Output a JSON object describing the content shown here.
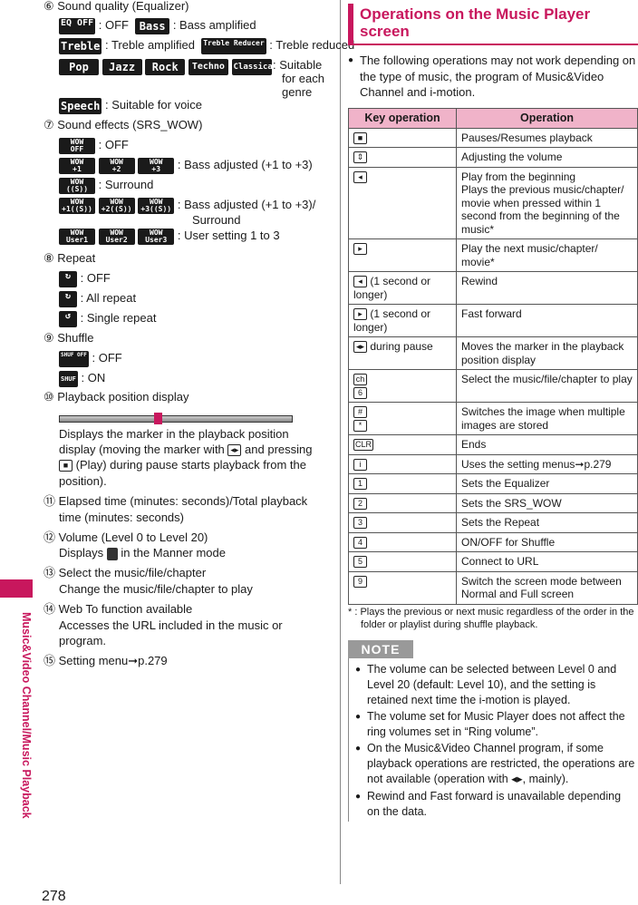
{
  "left": {
    "s6": {
      "title": "⑥ Sound quality (Equalizer)",
      "eq_off_icon": "EQ OFF",
      "eq_off": ": OFF",
      "bass_icon": "Bass",
      "bass": ": Bass amplified",
      "treble_icon": "Treble",
      "treble": ": Treble amplified",
      "treble_red_icon": "Treble Reducer",
      "treble_red": ": Treble reduced",
      "genres": [
        "Pop",
        "Jazz",
        "Rock",
        "Techno",
        "Classical"
      ],
      "genre_text1": ": Suitable",
      "genre_text2": "for each",
      "genre_text3": "genre",
      "speech_icon": "Speech",
      "speech": ": Suitable for voice"
    },
    "s7": {
      "title": "⑦ Sound effects (SRS_WOW)",
      "off_icon": "OFF",
      "off": ": OFF",
      "bass_icons": [
        "+1",
        "+2",
        "+3"
      ],
      "bass": ": Bass adjusted (+1 to +3)",
      "surround_icon": "((S))",
      "surround": ": Surround",
      "bs_icons": [
        "+1((S))",
        "+2((S))",
        "+3((S))"
      ],
      "bs1": ": Bass adjusted (+1 to +3)/",
      "bs2": "Surround",
      "user_icons": [
        "User1",
        "User2",
        "User3"
      ],
      "user": ": User setting 1 to 3",
      "wow": "WOW"
    },
    "s8": {
      "title": "⑧ Repeat",
      "off": ": OFF",
      "all": ": All repeat",
      "single": ": Single repeat"
    },
    "s9": {
      "title": "⑨ Shuffle",
      "off_icon": "SHUF OFF",
      "off": ": OFF",
      "on_icon": "SHUF",
      "on": ": ON"
    },
    "s10": {
      "title": "⑩ Playback position display",
      "l1": "Displays the marker in the playback position",
      "l2a": "display (moving the marker with",
      "l2b": "and pressing",
      "l3": "(Play) during pause starts playback from the",
      "l4": "position).",
      "marker_fraction": 0.42
    },
    "s11": {
      "l1": "⑪ Elapsed time (minutes: seconds)/Total playback",
      "l2": "time (minutes: seconds)"
    },
    "s12": {
      "l1": "⑫ Volume (Level 0 to Level 20)",
      "l2a": "Displays",
      "l2b": "in the Manner mode"
    },
    "s13": {
      "l1": "⑬ Select the music/file/chapter",
      "l2": "Change the music/file/chapter to play"
    },
    "s14": {
      "l1": "⑭ Web To function available",
      "l2": "Accesses the URL included in the music or",
      "l3": "program."
    },
    "s15": {
      "l1": "⑮ Setting menu➞p.279"
    }
  },
  "sidebar": {
    "label": "Music&Video Channel/Music Playback",
    "color": "#c8175d"
  },
  "page_number": "278",
  "right": {
    "heading": "Operations on the Music Player screen",
    "intro": "The following operations may not work depending on the type of music, the program of Music&Video Channel and i-motion.",
    "table": {
      "headers": [
        "Key operation",
        "Operation"
      ],
      "rows": [
        {
          "key": "■",
          "ktext": "",
          "op": "Pauses/Resumes playback"
        },
        {
          "key": "⇕",
          "ktext": "",
          "op": "Adjusting the volume"
        },
        {
          "key": "◂",
          "ktext": "",
          "op": "Play from the beginning\nPlays the previous music/chapter/ movie when pressed within 1 second from the beginning of the music*"
        },
        {
          "key": "▸",
          "ktext": "",
          "op": "Play the next music/chapter/ movie*"
        },
        {
          "key": "◂",
          "ktext": " (1 second or longer)",
          "op": "Rewind"
        },
        {
          "key": "▸",
          "ktext": " (1 second or longer)",
          "op": "Fast forward"
        },
        {
          "key": "◂▸",
          "ktext": " during pause",
          "op": "Moves the marker in the playback position display"
        },
        {
          "key": "ch\n6",
          "ktext": "",
          "op": "Select the music/file/chapter to play"
        },
        {
          "key": "#\n*",
          "ktext": "",
          "op": "Switches the image when multiple images are stored"
        },
        {
          "key": "CLR",
          "ktext": "",
          "op": "Ends"
        },
        {
          "key": "i",
          "ktext": "",
          "op": "Uses the setting menus➞p.279"
        },
        {
          "key": "1",
          "ktext": "",
          "op": "Sets the Equalizer"
        },
        {
          "key": "2",
          "ktext": "",
          "op": "Sets the SRS_WOW"
        },
        {
          "key": "3",
          "ktext": "",
          "op": "Sets the Repeat"
        },
        {
          "key": "4",
          "ktext": "",
          "op": "ON/OFF for Shuffle"
        },
        {
          "key": "5",
          "ktext": "",
          "op": "Connect to URL"
        },
        {
          "key": "9",
          "ktext": "",
          "op": "Switch the screen mode between Normal and Full screen"
        }
      ]
    },
    "footnote": "* : Plays the previous or next music regardless of the order in the folder or playlist during shuffle playback.",
    "note_label": "NOTE",
    "notes": [
      "The volume can be selected between Level 0 and Level 20 (default: Level 10), and the setting is retained next time the i-motion is played.",
      "The volume set for Music Player does not affect the ring volumes set in “Ring volume”.",
      "On the Music&Video Channel program, if some playback operations are restricted, the operations are not available (operation with ◂▸, mainly).",
      "Rewind and Fast forward is unavailable depending on the data."
    ]
  }
}
